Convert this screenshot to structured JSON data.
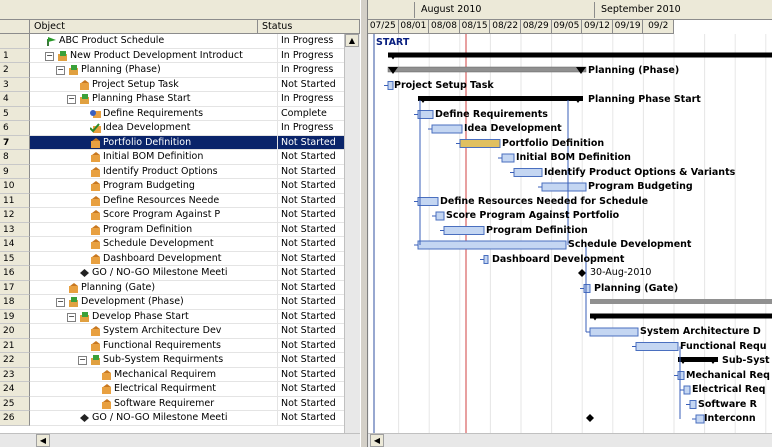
{
  "grid": {
    "col_object": "Object",
    "col_status": "Status",
    "rows": [
      {
        "num": "",
        "indent": 0,
        "toggle": "",
        "icon": "project-icon",
        "name": "ABC Product Schedule",
        "status": "In Progress"
      },
      {
        "num": "1",
        "indent": 1,
        "toggle": "−",
        "icon": "phase-icon",
        "name": "New Product Development Introduct",
        "status": "In Progress"
      },
      {
        "num": "2",
        "indent": 2,
        "toggle": "−",
        "icon": "phase-icon",
        "name": "Planning (Phase)",
        "status": "In Progress"
      },
      {
        "num": "3",
        "indent": 3,
        "toggle": "",
        "icon": "task-icon",
        "name": "Project Setup Task",
        "status": "Not Started"
      },
      {
        "num": "4",
        "indent": 3,
        "toggle": "−",
        "icon": "phase-icon",
        "name": "Planning Phase Start",
        "status": "In Progress"
      },
      {
        "num": "5",
        "indent": 4,
        "toggle": "",
        "icon": "requirements-icon",
        "name": "Define Requirements",
        "status": "Complete"
      },
      {
        "num": "6",
        "indent": 4,
        "toggle": "",
        "icon": "check-icon",
        "name": "Idea Development",
        "status": "In Progress"
      },
      {
        "num": "7",
        "indent": 4,
        "toggle": "",
        "icon": "task-icon",
        "name": "Portfolio Definition",
        "status": "Not Started"
      },
      {
        "num": "8",
        "indent": 4,
        "toggle": "",
        "icon": "task-icon",
        "name": "Initial BOM Definition",
        "status": "Not Started"
      },
      {
        "num": "9",
        "indent": 4,
        "toggle": "",
        "icon": "task-icon",
        "name": "Identify Product Options",
        "status": "Not Started"
      },
      {
        "num": "10",
        "indent": 4,
        "toggle": "",
        "icon": "task-icon",
        "name": "Program Budgeting",
        "status": "Not Started"
      },
      {
        "num": "11",
        "indent": 4,
        "toggle": "",
        "icon": "task-icon",
        "name": "Define Resources Neede",
        "status": "Not Started"
      },
      {
        "num": "12",
        "indent": 4,
        "toggle": "",
        "icon": "task-icon",
        "name": "Score Program Against P",
        "status": "Not Started"
      },
      {
        "num": "13",
        "indent": 4,
        "toggle": "",
        "icon": "task-icon",
        "name": "Program Definition",
        "status": "Not Started"
      },
      {
        "num": "14",
        "indent": 4,
        "toggle": "",
        "icon": "task-icon",
        "name": "Schedule Development",
        "status": "Not Started"
      },
      {
        "num": "15",
        "indent": 4,
        "toggle": "",
        "icon": "task-icon",
        "name": "Dashboard Development",
        "status": "Not Started"
      },
      {
        "num": "16",
        "indent": 3,
        "toggle": "",
        "icon": "diamond-icon",
        "name": "GO / NO-GO Milestone Meeti",
        "status": "Not Started"
      },
      {
        "num": "17",
        "indent": 2,
        "toggle": "",
        "icon": "task-icon",
        "name": "Planning (Gate)",
        "status": "Not Started"
      },
      {
        "num": "18",
        "indent": 2,
        "toggle": "−",
        "icon": "phase-icon",
        "name": "Development (Phase)",
        "status": "Not Started"
      },
      {
        "num": "19",
        "indent": 3,
        "toggle": "−",
        "icon": "phase-icon",
        "name": "Develop Phase Start",
        "status": "Not Started"
      },
      {
        "num": "20",
        "indent": 4,
        "toggle": "",
        "icon": "task-icon",
        "name": "System Architecture Dev",
        "status": "Not Started"
      },
      {
        "num": "21",
        "indent": 4,
        "toggle": "",
        "icon": "task-icon",
        "name": "Functional Requirements",
        "status": "Not Started"
      },
      {
        "num": "22",
        "indent": 4,
        "toggle": "−",
        "icon": "phase-icon",
        "name": "Sub-System Requirments",
        "status": "Not Started"
      },
      {
        "num": "23",
        "indent": 5,
        "toggle": "",
        "icon": "task-icon",
        "name": "Mechanical Requirem",
        "status": "Not Started"
      },
      {
        "num": "24",
        "indent": 5,
        "toggle": "",
        "icon": "task-icon",
        "name": "Electrical Requirment",
        "status": "Not Started"
      },
      {
        "num": "25",
        "indent": 5,
        "toggle": "",
        "icon": "task-icon",
        "name": "Software Requiremer",
        "status": "Not Started"
      },
      {
        "num": "26",
        "indent": 3,
        "toggle": "",
        "icon": "diamond-icon",
        "name": "GO / NO-GO Milestone Meeti",
        "status": "Not Started"
      }
    ],
    "selected_row": 7
  },
  "gantt": {
    "months": [
      "August 2010",
      "September 2010"
    ],
    "weeks": [
      "07/25",
      "08/01",
      "08/08",
      "08/15",
      "08/22",
      "08/29",
      "09/05",
      "09/12",
      "09/19",
      "09/2"
    ],
    "start_label": "START",
    "milestone_date": "30-Aug-2010",
    "bars": [
      {
        "row": 2,
        "type": "summary",
        "label": "Planning  (Phase)"
      },
      {
        "row": 3,
        "type": "task",
        "label": "Project Setup Task"
      },
      {
        "row": 4,
        "type": "summary",
        "label": "Planning Phase Start"
      },
      {
        "row": 5,
        "type": "task",
        "label": "Define Requirements"
      },
      {
        "row": 6,
        "type": "task",
        "label": "Idea Development"
      },
      {
        "row": 7,
        "type": "task",
        "label": "Portfolio Definition"
      },
      {
        "row": 8,
        "type": "task",
        "label": "Initial BOM Definition"
      },
      {
        "row": 9,
        "type": "task",
        "label": "Identify Product Options & Variants"
      },
      {
        "row": 10,
        "type": "task",
        "label": "Program Budgeting"
      },
      {
        "row": 11,
        "type": "task",
        "label": "Define Resources Needed for Schedule"
      },
      {
        "row": 12,
        "type": "task",
        "label": "Score Program Against Portfolio"
      },
      {
        "row": 13,
        "type": "task",
        "label": "Program Definition"
      },
      {
        "row": 14,
        "type": "task",
        "label": "Schedule Development"
      },
      {
        "row": 15,
        "type": "task",
        "label": "Dashboard Development"
      },
      {
        "row": 17,
        "type": "task",
        "label": "Planning  (Gate)"
      },
      {
        "row": 20,
        "type": "task",
        "label": "System Architecture D"
      },
      {
        "row": 21,
        "type": "task",
        "label": "Functional Requ"
      },
      {
        "row": 22,
        "type": "summary",
        "label": "Sub-Syst"
      },
      {
        "row": 23,
        "type": "task",
        "label": "Mechanical Req"
      },
      {
        "row": 24,
        "type": "task",
        "label": "Electrical Req"
      },
      {
        "row": 25,
        "type": "task",
        "label": "Software R"
      },
      {
        "row": 26,
        "type": "task",
        "label": "Interconn"
      }
    ]
  }
}
